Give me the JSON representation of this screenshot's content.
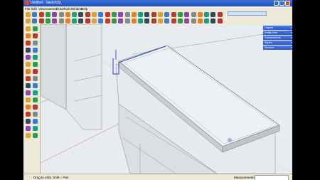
{
  "window": {
    "title": "Untitled - SketchUp"
  },
  "menu": {
    "items": [
      "File",
      "Edit",
      "View",
      "Camera",
      "Draw",
      "Tools",
      "Window",
      "Help"
    ]
  },
  "trays": [
    {
      "label": "Layers"
    },
    {
      "label": "Entity Info"
    },
    {
      "label": "Components"
    },
    {
      "label": "Styles"
    },
    {
      "label": "Scenes"
    }
  ],
  "status": {
    "hint": "Drag to orbit.  Shift = Pan",
    "measurements_label": "Measurements",
    "measurements_value": ""
  },
  "colors": {
    "title_bar": "#2456c8",
    "chrome": "#ece9d8",
    "viewport_bg": "#e8ecef",
    "selection_blue": "#1a2fd0",
    "axis_green": "#3a9a3a",
    "axis_red": "#c83c3c"
  },
  "icons": {
    "toolbar": [
      "new-icon",
      "open-icon",
      "save-icon",
      "cut-icon",
      "copy-icon",
      "paste-icon",
      "erase-icon",
      "undo-icon",
      "redo-icon",
      "print-icon",
      "user-icon",
      "select-icon",
      "component-icon",
      "paint-icon",
      "eraser-icon",
      "rectangle-icon",
      "line-icon",
      "circle-icon",
      "arc-icon",
      "polygon-icon",
      "freehand-icon",
      "move-icon",
      "pushpull-icon",
      "rotate-icon",
      "followme-icon",
      "scale-icon",
      "offset-icon",
      "tape-icon",
      "dimension-icon",
      "protractor-icon",
      "text-icon",
      "axes-icon",
      "3dtext-icon",
      "orbit-icon",
      "pan-icon",
      "zoom-icon",
      "zoomwindow-icon",
      "zoomext-icon",
      "previous-icon",
      "next-icon",
      "position-camera-icon",
      "walk-icon",
      "lookaround-icon",
      "section-icon",
      "iso-icon",
      "top-icon",
      "front-icon",
      "right-icon",
      "back-icon",
      "left-icon",
      "xray-icon",
      "wireframe-icon",
      "hidden-line-icon",
      "shaded-icon",
      "textured-icon",
      "monochrome-icon",
      "shadows-icon",
      "fog-icon",
      "warehouse-icon",
      "share-icon"
    ],
    "left": [
      "select-icon",
      "component-icon",
      "paint-icon",
      "eraser-icon",
      "rectangle-icon",
      "line-icon",
      "circle-icon",
      "arc-icon",
      "polygon-icon",
      "freehand-icon",
      "move-icon",
      "pushpull-icon",
      "rotate-icon",
      "followme-icon",
      "scale-icon",
      "offset-icon",
      "tape-icon",
      "dimension-icon",
      "protractor-icon",
      "text-icon",
      "axes-icon",
      "3dtext-icon",
      "orbit-icon",
      "pan-icon",
      "zoom-icon",
      "zoomwindow-icon",
      "zoomext-icon",
      "previous-icon",
      "position-camera-icon",
      "walk-icon",
      "lookaround-icon",
      "section-icon"
    ]
  }
}
